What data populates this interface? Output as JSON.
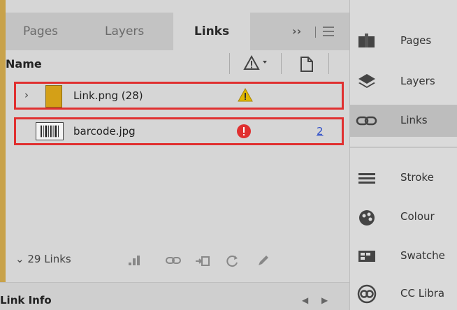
{
  "tabs": [
    {
      "label": "Pages",
      "active": false
    },
    {
      "label": "Layers",
      "active": false
    },
    {
      "label": "Links",
      "active": true
    }
  ],
  "tab_more": "››",
  "columns": {
    "name": "Name"
  },
  "links": [
    {
      "label": "Link.png (28)",
      "thumb": "gold-swatch",
      "status": "warning-icon",
      "page": ""
    },
    {
      "label": "barcode.jpg",
      "thumb": "barcode",
      "status": "missing-link-icon",
      "page": "2"
    }
  ],
  "footer": {
    "count": "29 Links"
  },
  "link_info": {
    "label": "Link Info"
  },
  "side_panels": [
    {
      "label": "Pages",
      "icon": "pages-icon",
      "active": false
    },
    {
      "label": "Layers",
      "icon": "layers-icon",
      "active": false
    },
    {
      "label": "Links",
      "icon": "links-icon",
      "active": true
    },
    {
      "label": "Stroke",
      "icon": "stroke-icon",
      "active": false
    },
    {
      "label": "Colour",
      "icon": "colour-icon",
      "active": false
    },
    {
      "label": "Swatche",
      "icon": "swatches-icon",
      "active": false
    },
    {
      "label": "CC Libra",
      "icon": "cc-libraries-icon",
      "active": false
    }
  ],
  "colors": {
    "highlight": "#e03030",
    "warning": "#e0b800",
    "error": "#e03030",
    "page_link": "#3050c8"
  }
}
